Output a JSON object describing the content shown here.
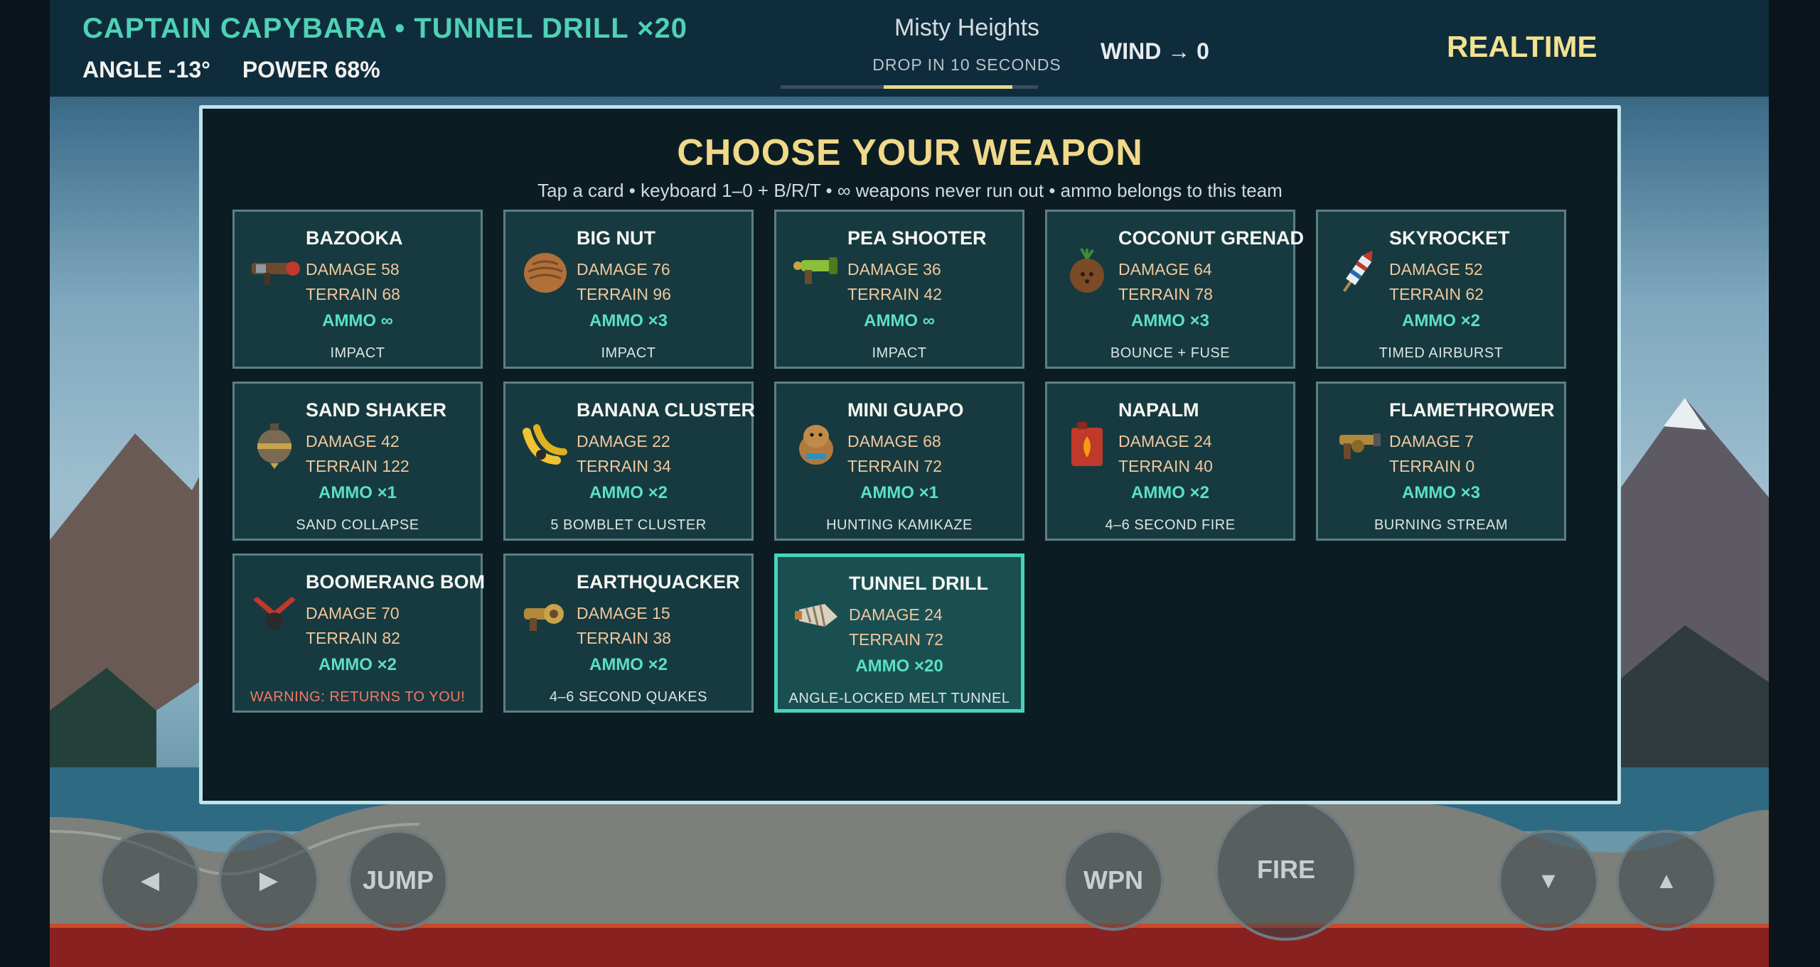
{
  "hud": {
    "title": "CAPTAIN CAPYBARA  •  TUNNEL DRILL  ×20",
    "angle": "ANGLE -13°",
    "power": "POWER 68%",
    "map_name": "Misty Heights",
    "drop_text": "DROP IN 10 SECONDS",
    "drop_progress": 0.5,
    "wind": "WIND → 0",
    "mode": "REALTIME"
  },
  "modal": {
    "title": "CHOOSE YOUR WEAPON",
    "hint": "Tap a card  •  keyboard 1–0 + B/R/T  •  ∞ weapons never run out  •  ammo belongs to this team"
  },
  "weapons": [
    {
      "name": "BAZOOKA",
      "damage": "DAMAGE 58",
      "terrain": "TERRAIN 68",
      "ammo": "AMMO ∞",
      "note": "IMPACT",
      "icon": "bazooka-icon"
    },
    {
      "name": "BIG NUT",
      "damage": "DAMAGE 76",
      "terrain": "TERRAIN 96",
      "ammo": "AMMO ×3",
      "note": "IMPACT",
      "icon": "walnut-icon"
    },
    {
      "name": "PEA SHOOTER",
      "damage": "DAMAGE 36",
      "terrain": "TERRAIN 42",
      "ammo": "AMMO ∞",
      "note": "IMPACT",
      "icon": "pea-shooter-icon"
    },
    {
      "name": "COCONUT GRENAD",
      "damage": "DAMAGE 64",
      "terrain": "TERRAIN 78",
      "ammo": "AMMO ×3",
      "note": "BOUNCE + FUSE",
      "icon": "coconut-icon"
    },
    {
      "name": "SKYROCKET",
      "damage": "DAMAGE 52",
      "terrain": "TERRAIN 62",
      "ammo": "AMMO ×2",
      "note": "TIMED AIRBURST",
      "icon": "rocket-icon"
    },
    {
      "name": "SAND SHAKER",
      "damage": "DAMAGE 42",
      "terrain": "TERRAIN 122",
      "ammo": "AMMO ×1",
      "note": "SAND COLLAPSE",
      "icon": "sand-bomb-icon"
    },
    {
      "name": "BANANA CLUSTER",
      "damage": "DAMAGE 22",
      "terrain": "TERRAIN 34",
      "ammo": "AMMO ×2",
      "note": "5 BOMBLET CLUSTER",
      "icon": "banana-icon"
    },
    {
      "name": "MINI GUAPO",
      "damage": "DAMAGE 68",
      "terrain": "TERRAIN 72",
      "ammo": "AMMO ×1",
      "note": "HUNTING KAMIKAZE",
      "icon": "capybara-icon"
    },
    {
      "name": "NAPALM",
      "damage": "DAMAGE 24",
      "terrain": "TERRAIN 40",
      "ammo": "AMMO ×2",
      "note": "4–6 SECOND FIRE",
      "icon": "fuel-can-icon"
    },
    {
      "name": "FLAMETHROWER",
      "damage": "DAMAGE 7",
      "terrain": "TERRAIN 0",
      "ammo": "AMMO ×3",
      "note": "BURNING STREAM",
      "icon": "flamethrower-icon"
    },
    {
      "name": "BOOMERANG BOM",
      "damage": "DAMAGE 70",
      "terrain": "TERRAIN 82",
      "ammo": "AMMO ×2",
      "note": "WARNING: RETURNS TO YOU!",
      "icon": "boomerang-icon"
    },
    {
      "name": "EARTHQUACKER",
      "damage": "DAMAGE 15",
      "terrain": "TERRAIN 38",
      "ammo": "AMMO ×2",
      "note": "4–6 SECOND QUAKES",
      "icon": "earthquacker-icon"
    },
    {
      "name": "TUNNEL DRILL",
      "damage": "DAMAGE 24",
      "terrain": "TERRAIN 72",
      "ammo": "AMMO ×20",
      "note": "ANGLE-LOCKED MELT TUNNEL",
      "icon": "drill-icon"
    }
  ],
  "selected_weapon": "TUNNEL DRILL",
  "controls": {
    "left": "◀",
    "right": "▶",
    "jump": "JUMP",
    "weapon": "WPN",
    "fire": "FIRE",
    "down": "▼",
    "up": "▲"
  },
  "colors": {
    "accent": "#47d4bb",
    "title": "#f1d98a",
    "warning": "#f07a6a"
  }
}
